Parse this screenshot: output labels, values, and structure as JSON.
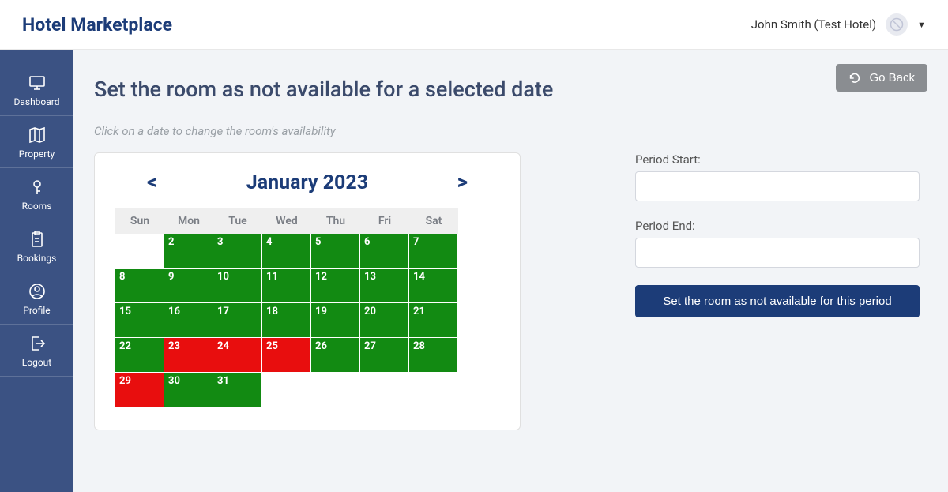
{
  "header": {
    "brand": "Hotel Marketplace",
    "user_label": "John Smith (Test Hotel)"
  },
  "sidebar": {
    "items": [
      {
        "label": "Dashboard"
      },
      {
        "label": "Property"
      },
      {
        "label": "Rooms"
      },
      {
        "label": "Bookings"
      },
      {
        "label": "Profile"
      },
      {
        "label": "Logout"
      }
    ]
  },
  "actions": {
    "go_back_label": "Go Back"
  },
  "page": {
    "title": "Set the room as not available for a selected date",
    "hint": "Click on a date to change the room's availability"
  },
  "calendar": {
    "nav_prev": "<",
    "nav_next": ">",
    "month_label": "January 2023",
    "dow": [
      "Sun",
      "Mon",
      "Tue",
      "Wed",
      "Thu",
      "Fri",
      "Sat"
    ],
    "days": [
      {
        "n": "",
        "status": "blank"
      },
      {
        "n": "2",
        "status": "avail"
      },
      {
        "n": "3",
        "status": "avail"
      },
      {
        "n": "4",
        "status": "avail"
      },
      {
        "n": "5",
        "status": "avail"
      },
      {
        "n": "6",
        "status": "avail"
      },
      {
        "n": "7",
        "status": "avail"
      },
      {
        "n": "8",
        "status": "avail"
      },
      {
        "n": "9",
        "status": "avail"
      },
      {
        "n": "10",
        "status": "avail"
      },
      {
        "n": "11",
        "status": "avail"
      },
      {
        "n": "12",
        "status": "avail"
      },
      {
        "n": "13",
        "status": "avail"
      },
      {
        "n": "14",
        "status": "avail"
      },
      {
        "n": "15",
        "status": "avail"
      },
      {
        "n": "16",
        "status": "avail"
      },
      {
        "n": "17",
        "status": "avail"
      },
      {
        "n": "18",
        "status": "avail"
      },
      {
        "n": "19",
        "status": "avail"
      },
      {
        "n": "20",
        "status": "avail"
      },
      {
        "n": "21",
        "status": "avail"
      },
      {
        "n": "22",
        "status": "avail"
      },
      {
        "n": "23",
        "status": "unavail"
      },
      {
        "n": "24",
        "status": "unavail"
      },
      {
        "n": "25",
        "status": "unavail"
      },
      {
        "n": "26",
        "status": "avail"
      },
      {
        "n": "27",
        "status": "avail"
      },
      {
        "n": "28",
        "status": "avail"
      },
      {
        "n": "29",
        "status": "unavail"
      },
      {
        "n": "30",
        "status": "avail"
      },
      {
        "n": "31",
        "status": "avail"
      }
    ]
  },
  "form": {
    "period_start_label": "Period Start:",
    "period_start_value": "",
    "period_end_label": "Period End:",
    "period_end_value": "",
    "submit_label": "Set the room as not available for this period"
  },
  "colors": {
    "brand": "#1c3c78",
    "sidebar": "#3b5283",
    "available": "#128a12",
    "unavailable": "#e80e0e",
    "go_back_btn": "#8a8d91"
  }
}
